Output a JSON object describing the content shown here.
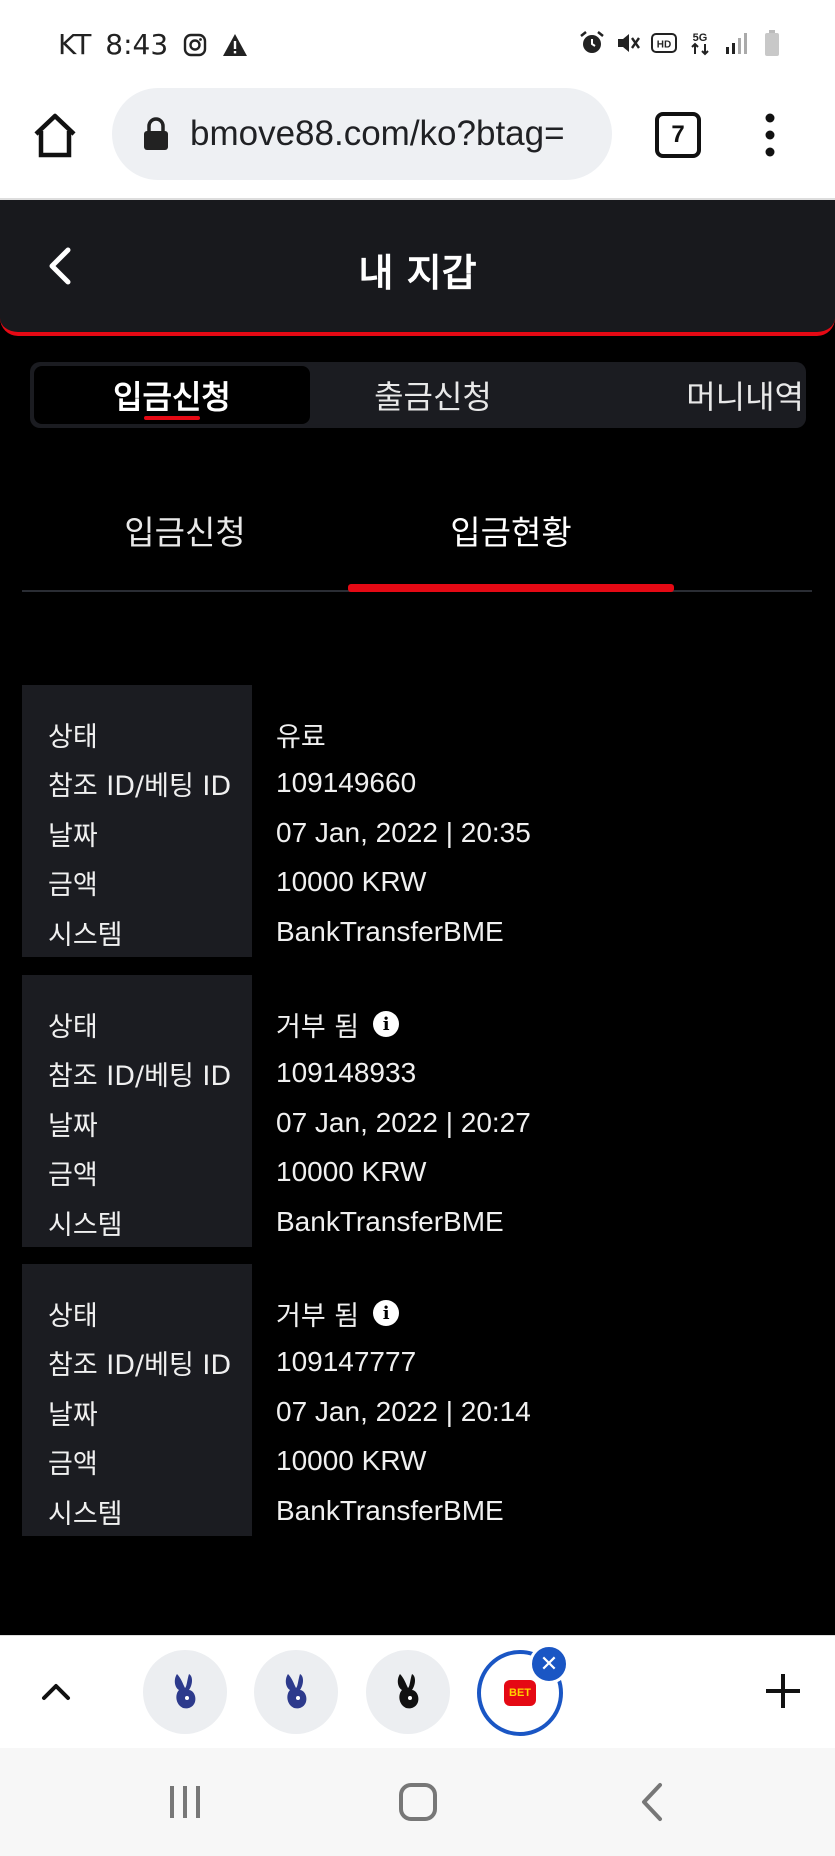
{
  "status_bar": {
    "carrier": "KT",
    "time": "8:43",
    "left_icons": [
      "instagram-icon",
      "warning-icon"
    ],
    "right_icons": [
      "alarm-icon",
      "mute-icon",
      "hd-icon",
      "5g-icon",
      "signal-icon",
      "battery-icon"
    ]
  },
  "browser": {
    "url": "bmove88.com/ko?btag=",
    "tab_count": "7"
  },
  "header": {
    "title": "내 지갑"
  },
  "segment_tabs": [
    {
      "label": "입금신청",
      "active": true
    },
    {
      "label": "출금신청",
      "active": false
    },
    {
      "label": "머니내역",
      "active": false
    }
  ],
  "sub_tabs": [
    {
      "label": "입금신청",
      "active": false
    },
    {
      "label": "입금현황",
      "active": true
    }
  ],
  "record_labels": {
    "status": "상태",
    "ref_id": "참조 ID/베팅 ID",
    "date": "날짜",
    "amount": "금액",
    "system": "시스템"
  },
  "records": [
    {
      "status": "유료",
      "has_info": false,
      "ref_id": "109149660",
      "date": "07 Jan, 2022 | 20:35",
      "amount": "10000 KRW",
      "system": "BankTransferBME"
    },
    {
      "status": "거부 됨",
      "has_info": true,
      "ref_id": "109148933",
      "date": "07 Jan, 2022 | 20:27",
      "amount": "10000 KRW",
      "system": "BankTransferBME"
    },
    {
      "status": "거부 됨",
      "has_info": true,
      "ref_id": "109147777",
      "date": "07 Jan, 2022 | 20:14",
      "amount": "10000 KRW",
      "system": "BankTransferBME"
    }
  ],
  "bubbles": {
    "bet_label": "BET",
    "close_glyph": "✕"
  },
  "colors": {
    "accent": "#e50914",
    "background": "#000000",
    "panel": "#1b1c21",
    "bubble_blue": "#1a56c4"
  }
}
